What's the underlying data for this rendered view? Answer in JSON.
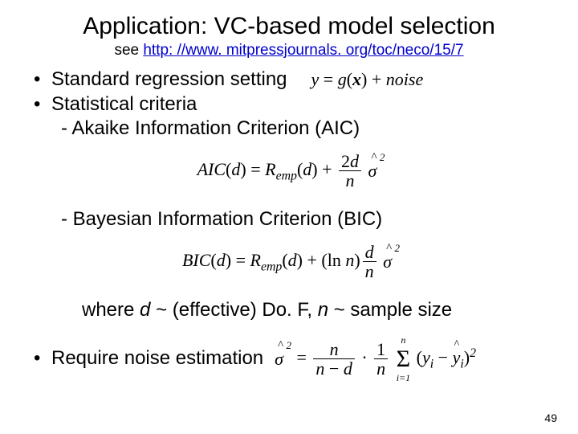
{
  "title": "Application: VC-based model selection",
  "see_label": "see",
  "link_text": "http: //www. mitpressjournals. org/toc/neco/15/7",
  "link_href": "http://www.mitpressjournals.org/toc/neco/15/7",
  "bullets": {
    "b1": "Standard regression setting",
    "b2": "Statistical criteria",
    "b2a": "- Akaike Information Criterion (AIC)",
    "b2b": "- Bayesian Information Criterion (BIC)",
    "where": "where d ~ (effective) Do. F, n ~ sample size",
    "b3": "Require noise estimation"
  },
  "eq": {
    "model": "y = g(x) + noise",
    "aic_lhs": "AIC(d) = R",
    "aic_emp": "emp",
    "aic_mid": "(d) + ",
    "bic_lhs": "BIC(d) = R",
    "bic_mid": "(d) + (ln n)",
    "two_d": "2d",
    "d": "d",
    "n": "n",
    "sigma": "σ",
    "caret": "^",
    "sq": "2",
    "noise_eq_pre": " = ",
    "n_minus_d": "n − d",
    "dot": " · ",
    "one": "1",
    "sum": "Σ",
    "sum_top": "n",
    "sum_bot": "i=1",
    "y": "y",
    "i": "i",
    "minus": " − ",
    "open": "(",
    "close": ")"
  },
  "page_number": "49"
}
